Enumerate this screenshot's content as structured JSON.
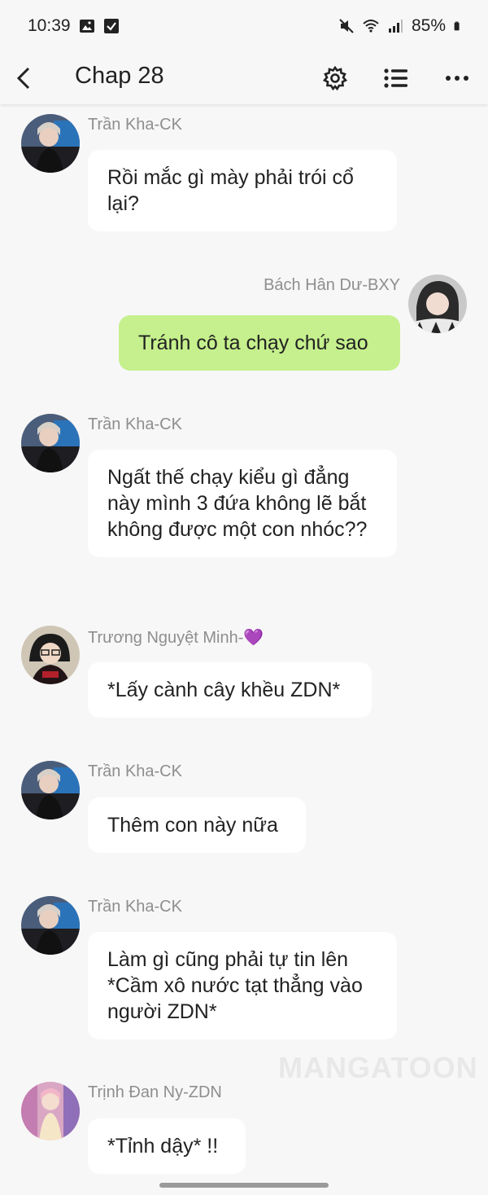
{
  "status_bar": {
    "time": "10:39",
    "battery": "85%"
  },
  "header": {
    "title": "Chap 28"
  },
  "messages": [
    {
      "sender": "Trần Kha-CK",
      "text": "Rồi mắc gì mày phải trói cổ lại?",
      "side": "left"
    },
    {
      "sender": "Bách Hân Dư-BXY",
      "text": "Tránh cô ta chạy chứ sao",
      "side": "right"
    },
    {
      "sender": "Trần Kha-CK",
      "text": "Ngất thế chạy kiểu gì đẳng này mình 3 đứa không lẽ bắt không được một con nhóc??",
      "side": "left"
    },
    {
      "sender": "Trương Nguyệt Minh-💜",
      "text": "*Lấy cành cây khều ZDN*",
      "side": "left"
    },
    {
      "sender": "Trần Kha-CK",
      "text": "Thêm con này nữa",
      "side": "left"
    },
    {
      "sender": "Trần Kha-CK",
      "text": "Làm gì cũng phải tự tin lên *Cầm xô nước tạt thẳng vào người ZDN*",
      "side": "left"
    },
    {
      "sender": "Trịnh Đan Ny-ZDN",
      "text": "*Tỉnh dậy* !!",
      "side": "left"
    }
  ],
  "watermark": "MANGATOON",
  "colors": {
    "background": "#f7f7f7",
    "bubble_other": "#ffffff",
    "bubble_mine": "#c5f08d",
    "name_text": "#8e8e8e"
  }
}
